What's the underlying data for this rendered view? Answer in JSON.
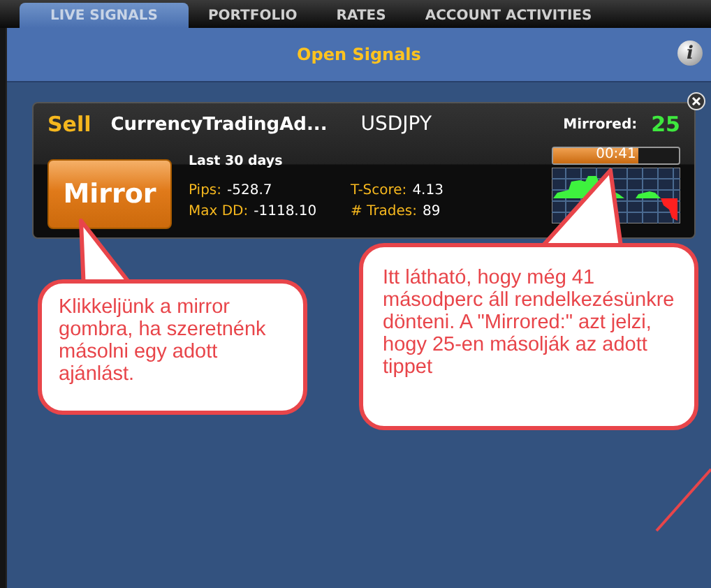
{
  "tabs": [
    {
      "label": "LIVE SIGNALS",
      "selected": true
    },
    {
      "label": "PORTFOLIO",
      "selected": false
    },
    {
      "label": "RATES",
      "selected": false
    },
    {
      "label": "ACCOUNT ACTIVITIES",
      "selected": false
    }
  ],
  "panel": {
    "title": "Open Signals",
    "info_icon": "i"
  },
  "signal": {
    "direction": "Sell",
    "provider": "CurrencyTradingAd...",
    "pair": "USDJPY",
    "mirrored_label": "Mirrored:",
    "mirrored_count": "25",
    "button": "Mirror",
    "period": "Last 30 days",
    "stats": [
      {
        "label": "Pips:",
        "value": "-528.7"
      },
      {
        "label": "T-Score:",
        "value": "4.13"
      },
      {
        "label": "Max DD:",
        "value": "-1118.10"
      },
      {
        "label": "# Trades:",
        "value": "89"
      }
    ],
    "timer": {
      "text": "00:41",
      "level": 0.68
    }
  },
  "callouts": [
    {
      "text": "Klikkeljünk a mirror gombra, ha szeretnénk másolni egy adott ajánlást."
    },
    {
      "text": "Itt látható, hogy még 41 másodperc áll rendelkezésünkre dönteni. A \"Mirrored:\" azt jelzi, hogy 25-en másolják az adott tippet"
    }
  ]
}
